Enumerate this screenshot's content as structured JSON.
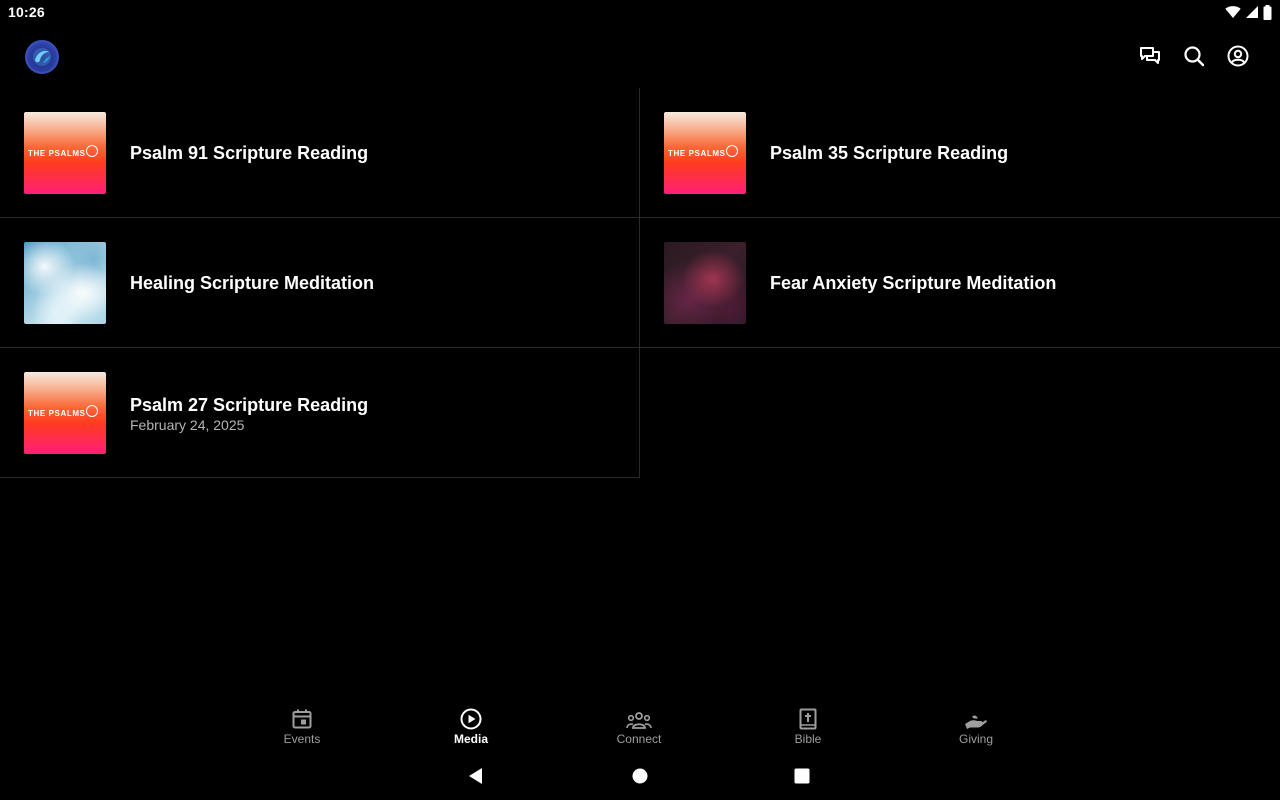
{
  "status_bar": {
    "time": "10:26",
    "icons": [
      "wifi-icon",
      "cellular-signal-icon",
      "battery-icon"
    ]
  },
  "app_bar": {
    "logo": "app-logo",
    "actions": [
      "chat-icon",
      "search-icon",
      "account-circle-icon"
    ]
  },
  "media": {
    "items": [
      {
        "title": "Psalm 91 Scripture Reading",
        "subtitle": "",
        "thumbnail": "the-psalms",
        "thumbnail_text": "THE PSALMS"
      },
      {
        "title": "Psalm 35 Scripture Reading",
        "subtitle": "",
        "thumbnail": "the-psalms",
        "thumbnail_text": "THE PSALMS"
      },
      {
        "title": "Healing Scripture Meditation",
        "subtitle": "",
        "thumbnail": "ice"
      },
      {
        "title": "Fear Anxiety Scripture Meditation",
        "subtitle": "",
        "thumbnail": "nebula"
      },
      {
        "title": "Psalm 27 Scripture Reading",
        "subtitle": "February 24, 2025",
        "thumbnail": "the-psalms",
        "thumbnail_text": "THE PSALMS"
      }
    ]
  },
  "bottom_nav": {
    "active": "Media",
    "items": [
      {
        "label": "Events",
        "icon": "calendar-icon"
      },
      {
        "label": "Media",
        "icon": "play-circle-icon"
      },
      {
        "label": "Connect",
        "icon": "groups-icon"
      },
      {
        "label": "Bible",
        "icon": "bible-icon"
      },
      {
        "label": "Giving",
        "icon": "giving-hand-icon"
      }
    ]
  },
  "system_nav": [
    "back-icon",
    "home-icon",
    "recents-icon"
  ],
  "colors": {
    "background": "#000000",
    "divider": "#2b2b2b",
    "inactive_nav": "#9e9e9e",
    "subtitle": "#b5b5b5"
  }
}
